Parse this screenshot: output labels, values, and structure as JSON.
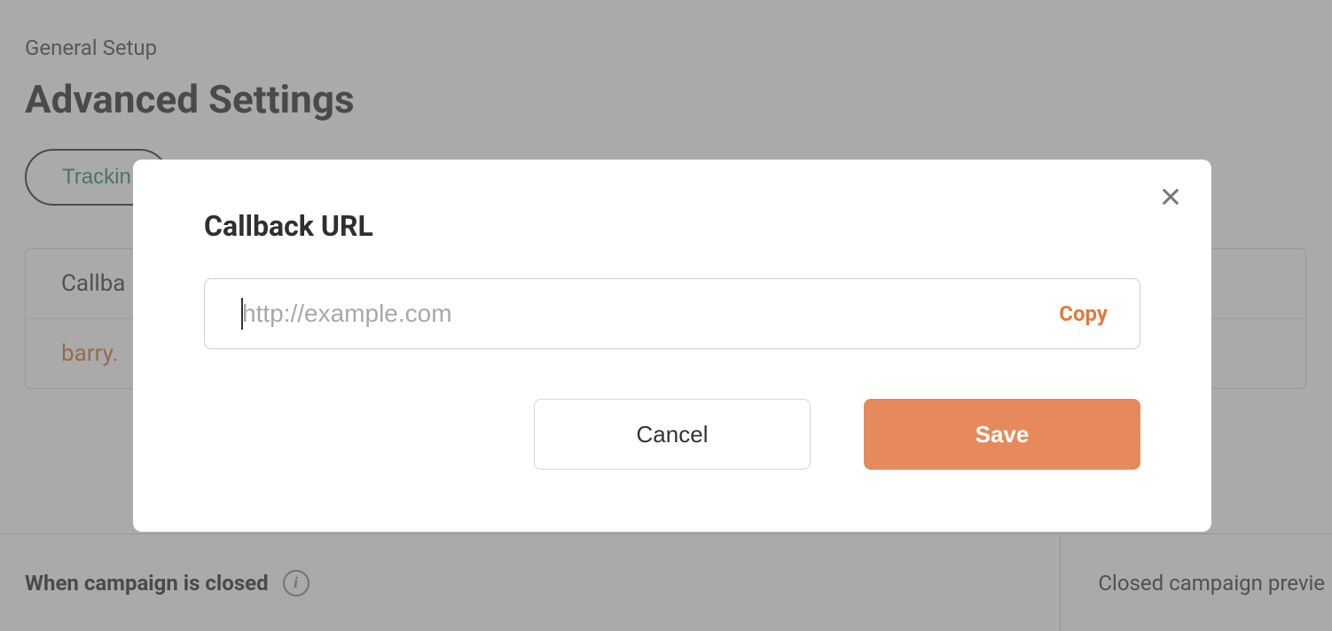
{
  "page": {
    "breadcrumb": "General Setup",
    "title": "Advanced Settings",
    "tab_label": "Trackin",
    "card": {
      "row1_label": "Callba",
      "row2_link": "barry."
    },
    "footer": {
      "left_label": "When campaign is closed",
      "right_label": "Closed campaign previe"
    }
  },
  "modal": {
    "title": "Callback URL",
    "input_placeholder": "http://example.com",
    "input_value": "",
    "copy_label": "Copy",
    "cancel_label": "Cancel",
    "save_label": "Save"
  }
}
